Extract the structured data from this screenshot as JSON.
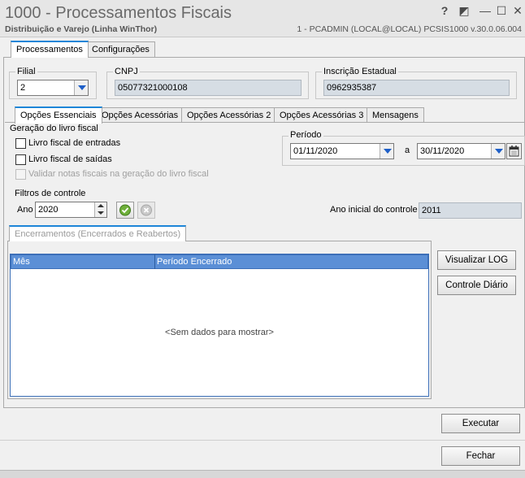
{
  "window": {
    "title": "1000 - Processamentos Fiscais",
    "subtitle": "Distribuição e Varejo (Linha WinThor)",
    "sysinfo": "1 - PCADMIN (LOCAL@LOCAL)   PCSIS1000  v.30.0.06.004",
    "help": "?",
    "restore": "◩",
    "minimize": "—",
    "maximize": "☐",
    "close": "✕"
  },
  "top_tabs": [
    {
      "label": "Processamentos"
    },
    {
      "label": "Configurações"
    }
  ],
  "filial": {
    "label": "Filial",
    "value": "2"
  },
  "cnpj": {
    "label": "CNPJ",
    "value": "05077321000108"
  },
  "ie": {
    "label": "Inscrição Estadual",
    "value": "0962935387"
  },
  "sub_tabs": [
    {
      "label": "Opções Essenciais"
    },
    {
      "label": "Opções Acessórias"
    },
    {
      "label": "Opções Acessórias 2"
    },
    {
      "label": "Opções Acessórias 3"
    },
    {
      "label": "Mensagens"
    }
  ],
  "geracao": {
    "label": "Geração do livro fiscal",
    "entradas": "Livro fiscal de entradas",
    "saidas": "Livro fiscal de saídas",
    "validar": "Validar notas fiscais na geração do livro fiscal"
  },
  "periodo": {
    "label": "Período",
    "inicio": "01/11/2020",
    "sep": "a",
    "fim": "30/11/2020"
  },
  "filtros": {
    "label": "Filtros de controle",
    "ano_label": "Ano",
    "ano_value": "2020",
    "ano_inicial_label": "Ano inicial do controle",
    "ano_inicial_value": "2011"
  },
  "encerramentos": {
    "tab_label": "Encerramentos (Encerrados e Reabertos)",
    "columns": [
      "Mês",
      "Período Encerrado"
    ],
    "empty": "<Sem dados para mostrar>"
  },
  "buttons": {
    "visualizar_log": "Visualizar LOG",
    "controle_diario": "Controle Diário",
    "executar": "Executar",
    "fechar": "Fechar"
  },
  "colors": {
    "accent": "#1e86d8",
    "grid_header": "#5b8fd6",
    "readonly_field": "#d6dde4"
  }
}
